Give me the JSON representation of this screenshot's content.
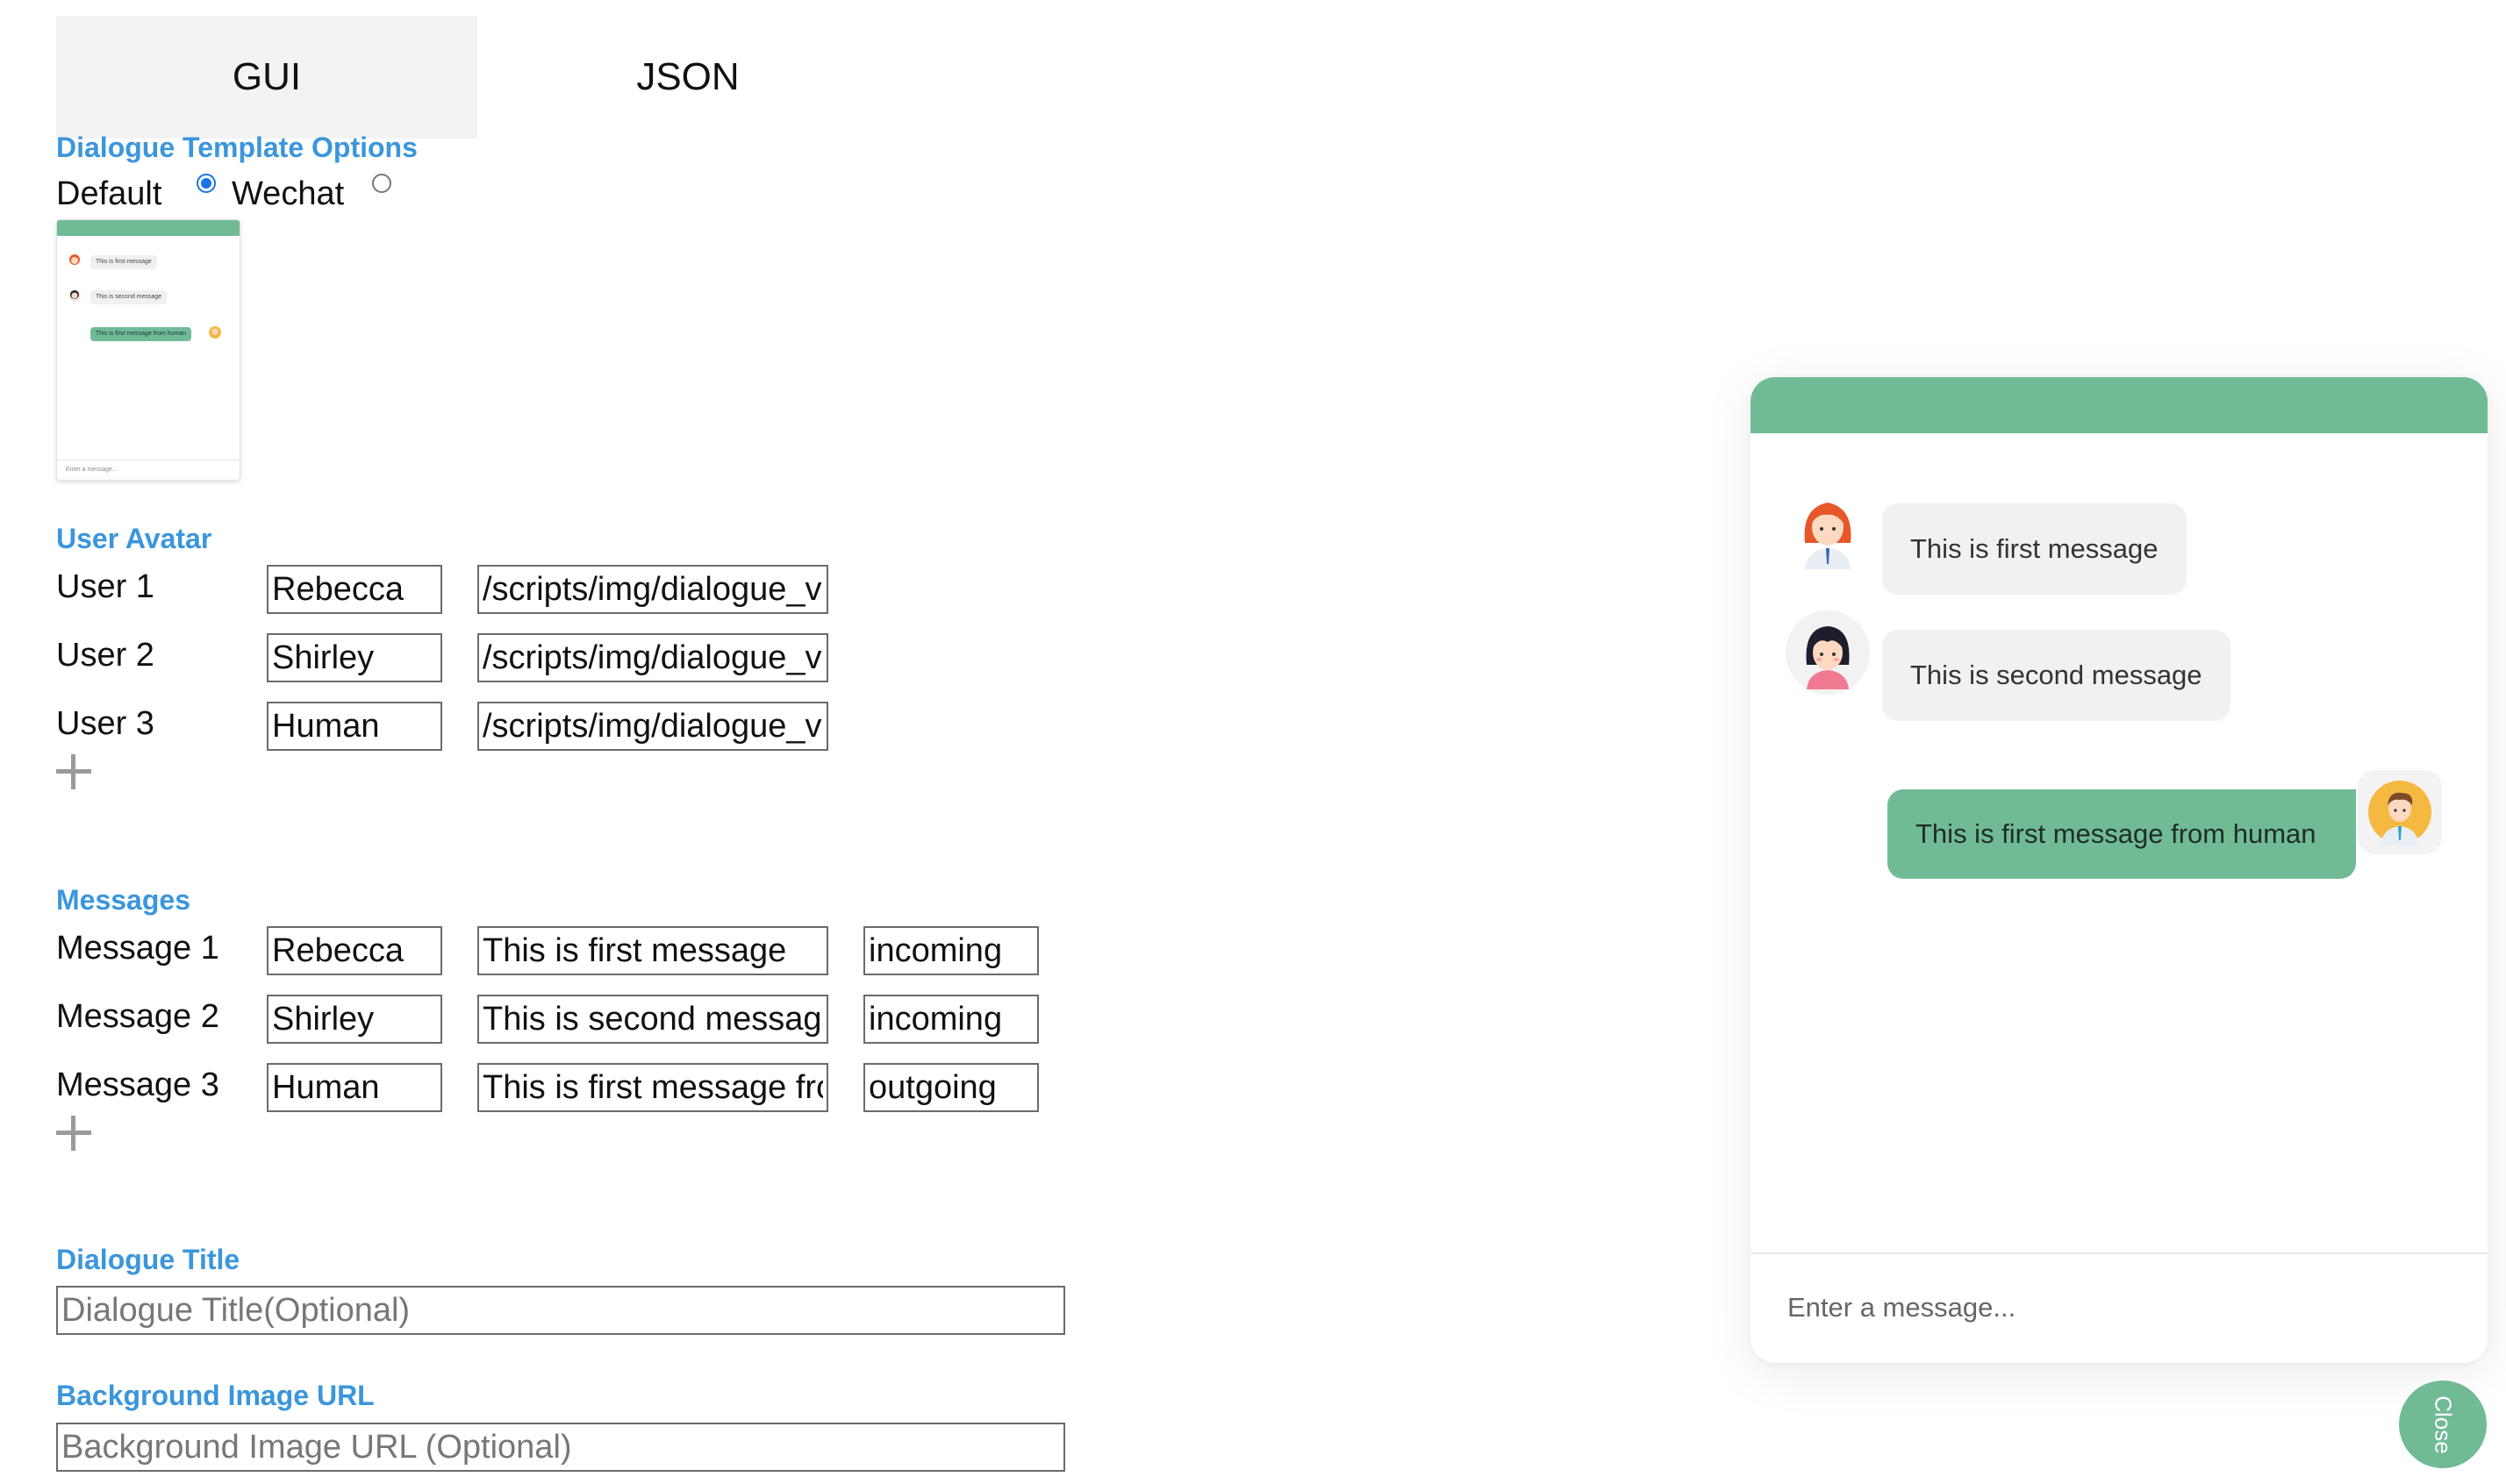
{
  "tabs": [
    {
      "label": "GUI",
      "active": true
    },
    {
      "label": "JSON",
      "active": false
    }
  ],
  "template": {
    "section_title": "Dialogue Template Options",
    "options": [
      {
        "label": "Default",
        "checked": true
      },
      {
        "label": "Wechat",
        "checked": false
      }
    ],
    "thumbnail": {
      "messages": [
        "This is first message",
        "This is second message",
        "This is first message from human"
      ],
      "input_placeholder": "Enter a message..."
    }
  },
  "avatars": {
    "section_title": "User Avatar",
    "users": [
      {
        "label": "User 1",
        "name": "Rebecca",
        "url": "/scripts/img/dialogue_vis/"
      },
      {
        "label": "User 2",
        "name": "Shirley",
        "url": "/scripts/img/dialogue_vis/"
      },
      {
        "label": "User 3",
        "name": "Human",
        "url": "/scripts/img/dialogue_vis/"
      }
    ]
  },
  "messages": {
    "section_title": "Messages",
    "items": [
      {
        "label": "Message 1",
        "sender": "Rebecca",
        "text": "This is first message",
        "direction": "incoming"
      },
      {
        "label": "Message 2",
        "sender": "Shirley",
        "text": "This is second message",
        "direction": "incoming"
      },
      {
        "label": "Message 3",
        "sender": "Human",
        "text": "This is first message from human",
        "direction": "outgoing"
      }
    ]
  },
  "dialogue_title": {
    "section_title": "Dialogue Title",
    "placeholder": "Dialogue Title(Optional)"
  },
  "background_image": {
    "section_title": "Background Image URL",
    "placeholder": "Background Image URL (Optional)"
  },
  "chat": {
    "messages": [
      {
        "text": "This is first message",
        "direction": "incoming",
        "avatar": "woman-red-hair-avatar"
      },
      {
        "text": "This is second message",
        "direction": "incoming",
        "avatar": "woman-black-hair-avatar"
      },
      {
        "text": "This is first message from human",
        "direction": "outgoing",
        "avatar": "man-avatar"
      }
    ],
    "input_placeholder": "Enter a message...",
    "close_label": "Close"
  },
  "colors": {
    "accent": "#70bb96",
    "section_title": "#3b96dc"
  }
}
